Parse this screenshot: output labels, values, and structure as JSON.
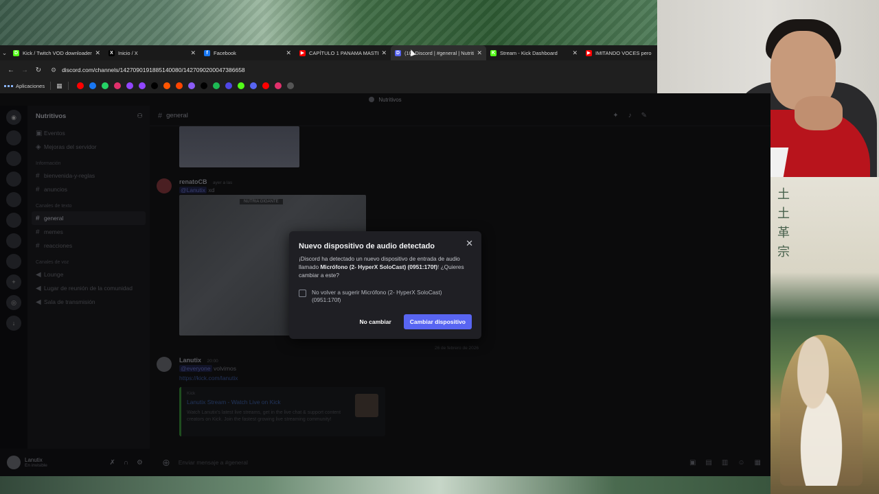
{
  "browser": {
    "tabs": [
      {
        "title": "Kick / Twitch VOD downloader",
        "fav_color": "#53fc18",
        "fav_glyph": "D",
        "active": false
      },
      {
        "title": "Inicio / X",
        "fav_color": "#000000",
        "fav_glyph": "X",
        "active": false
      },
      {
        "title": "Facebook",
        "fav_color": "#1877f2",
        "fav_glyph": "f",
        "active": false
      },
      {
        "title": "CAPÍTULO 1 PANAMA MASTER",
        "fav_color": "#ff0000",
        "fav_glyph": "▶",
        "active": false
      },
      {
        "title": "(10) Discord | #general | Nutriti",
        "fav_color": "#5865f2",
        "fav_glyph": "D",
        "active": true
      },
      {
        "title": "Stream - Kick Dashboard",
        "fav_color": "#53fc18",
        "fav_glyph": "K",
        "active": false
      },
      {
        "title": "IMITANDO VOCES pero es",
        "fav_color": "#ff0000",
        "fav_glyph": "▶",
        "active": false
      }
    ],
    "url": "discord.com/channels/1427090191885140080/1427090200047386658",
    "bookmarks_label": "Aplicaciones",
    "bookmark_icons": [
      "#ff0000",
      "#1877f2",
      "#25d366",
      "#e1306c",
      "#9146ff",
      "#9146ff",
      "#000000",
      "#ff5500",
      "#ff4500",
      "#8b5cf6",
      "#000000",
      "#1db954",
      "#4f46e5",
      "#53fc18",
      "#5865f2",
      "#ff0000",
      "#e1306c",
      "#555555"
    ]
  },
  "discord": {
    "title": "Nutritivos",
    "server_name": "Nutritivos",
    "channels": {
      "top": [
        "Eventos",
        "Mejoras del servidor"
      ],
      "category_info": "Información",
      "info_items": [
        "bienvenida-y-reglas",
        "anuncios"
      ],
      "category_text": "Canales de texto",
      "text_items": [
        {
          "name": "general",
          "active": true
        },
        {
          "name": "memes",
          "active": false
        },
        {
          "name": "reacciones",
          "active": false
        }
      ],
      "category_voice": "Canales de voz",
      "voice_items": [
        "Lounge",
        "Lugar de reunión de la comunidad",
        "Sala de transmisión"
      ]
    },
    "user": {
      "name": "Lanutix",
      "status": "En invisible"
    },
    "chat_header": "general",
    "messages": {
      "m1": {
        "author": "renatoCB",
        "time": "ayer a las",
        "body_mention": "@Lanutix",
        "body_text": " xd",
        "image_tag": "NUTRIA GIGANTE"
      },
      "date_separator": "26 de febrero de 2026",
      "m2": {
        "author": "Lanutix",
        "time": "20:00",
        "body_mention": "@everyone",
        "body_text": " volvimos",
        "link": "https://kick.com/lanutix"
      }
    },
    "embed": {
      "provider": "Kick",
      "title": "Lanutix Stream - Watch Live on Kick",
      "description": "Watch Lanutix's latest live streams, get in the live chat & support content creators on Kick. Join the fastest growing live streaming community!"
    },
    "composer_placeholder": "Enviar mensaje a #general"
  },
  "modal": {
    "title": "Nuevo dispositivo de audio detectado",
    "desc_prefix": "¡Discord ha detectado un nuevo dispositivo de entrada de audio llamado ",
    "device": "Micrófono (2- HyperX SoloCast) (0951:170f)",
    "desc_suffix": "! ¿Quieres cambiar a este?",
    "checkbox_label": "No volver a sugerir Micrófono (2- HyperX SoloCast) (0951:170f)",
    "checkbox_checked": false,
    "secondary_button": "No cambiar",
    "primary_button": "Cambiar dispositivo",
    "primary_color": "#5865f2"
  }
}
